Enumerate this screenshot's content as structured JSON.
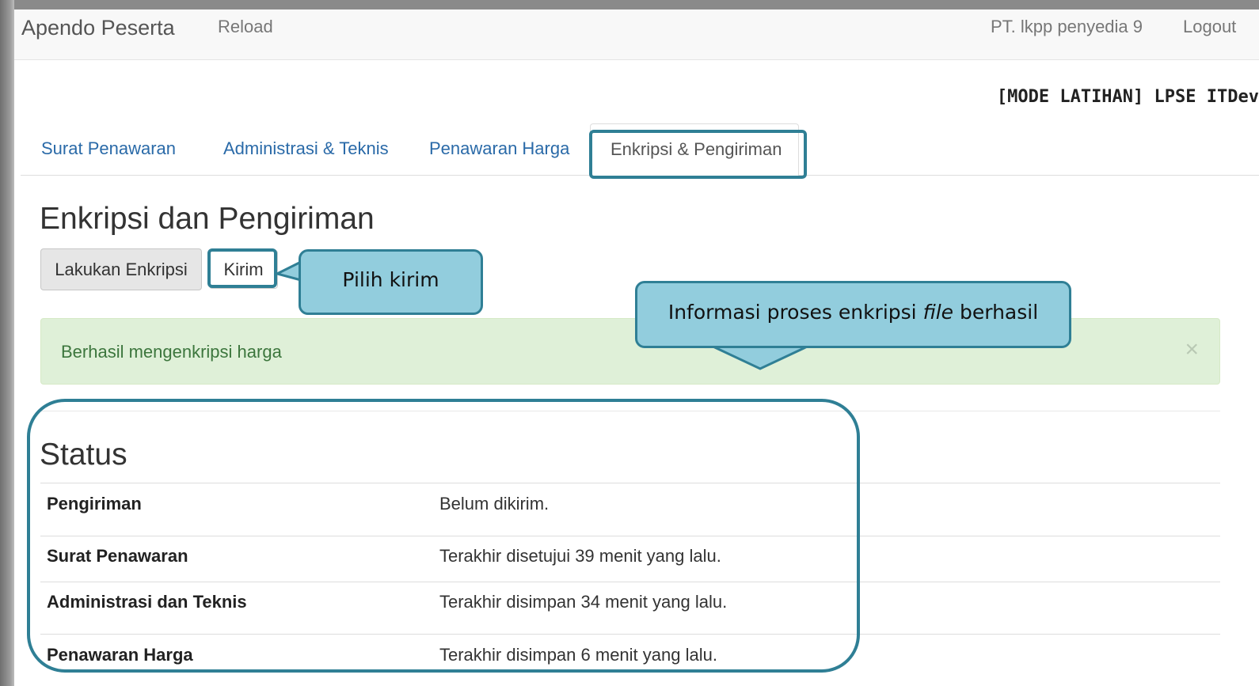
{
  "navbar": {
    "brand": "Apendo Peserta",
    "reload": "Reload",
    "user": "PT. lkpp penyedia 9",
    "logout": "Logout"
  },
  "mode_banner": "[MODE LATIHAN] LPSE ITDev",
  "tabs": [
    {
      "label": "Surat Penawaran"
    },
    {
      "label": "Administrasi & Teknis"
    },
    {
      "label": "Penawaran Harga"
    },
    {
      "label": "Enkripsi & Pengiriman",
      "active": true
    }
  ],
  "page_title": "Enkripsi dan Pengiriman",
  "buttons": {
    "encrypt": "Lakukan Enkripsi",
    "send": "Kirim"
  },
  "alert": {
    "message": "Berhasil mengenkripsi harga",
    "close": "×"
  },
  "status": {
    "title": "Status",
    "rows": [
      {
        "label": "Pengiriman",
        "value": "Belum dikirim."
      },
      {
        "label": "Surat Penawaran",
        "value": "Terakhir disetujui 39 menit yang lalu."
      },
      {
        "label": "Administrasi dan Teknis",
        "value": "Terakhir disimpan 34 menit yang lalu."
      },
      {
        "label": "Penawaran Harga",
        "value": "Terakhir disimpan 6 menit yang lalu."
      }
    ]
  },
  "annotations": {
    "pilih_kirim": "Pilih kirim",
    "info_pre": "Informasi proses enkripsi ",
    "info_italic": "file",
    "info_post": " berhasil",
    "color_fill": "#92cddd",
    "color_border": "#2f7f95"
  }
}
